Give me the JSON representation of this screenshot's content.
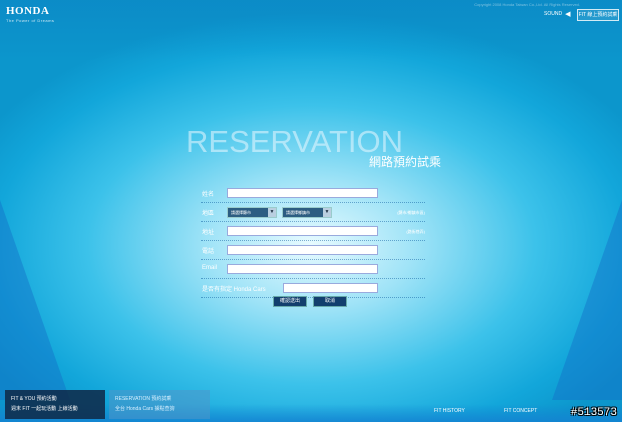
{
  "header": {
    "logo_text": "HONDA",
    "logo_sub": "The Power of Dreams",
    "copyright": "Copyright 2008 Honda Taiwan Co.,Ltd. All Rights Reserved.",
    "sound_label": "SOUND",
    "top_button": "FIT 線上預約試乘"
  },
  "page": {
    "title_en": "RESERVATION",
    "title_zh": "網路預約試乘"
  },
  "form": {
    "name_label": "姓名",
    "name_value": "",
    "region_label": "地區",
    "city_select": "請選擇縣市",
    "district_select": "請選擇鄉鎮市",
    "region_note": "(縣市/鄉鎮市區)",
    "address_label": "地址",
    "address_value": "",
    "address_note": "(路街巷弄)",
    "phone_label": "電話",
    "phone_value": "",
    "email_label": "Email",
    "email_value": "",
    "dealer_label": "是否有指定 Honda Cars",
    "dealer_value": "",
    "submit_label": "確認送出",
    "cancel_label": "取消"
  },
  "footer": {
    "panel_left": [
      "FIT & YOU 預約活動",
      "週末 FIT 一起玩活動 上線活動"
    ],
    "panel_mid": [
      "RESERVATION 預約試乘",
      "全台 Honda Cars 據點查詢"
    ],
    "nav_history": "FIT HISTORY",
    "nav_concept": "FIT CONCEPT",
    "watermark": "#513573"
  }
}
